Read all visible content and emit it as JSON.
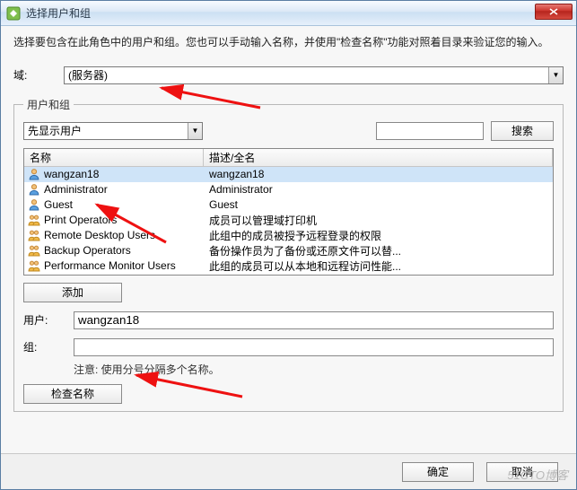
{
  "window": {
    "title": "选择用户和组"
  },
  "instruction": "选择要包含在此角色中的用户和组。您也可以手动输入名称，并使用\"检查名称\"功能对照着目录来验证您的输入。",
  "domain": {
    "label": "域:",
    "value": "(服务器)"
  },
  "group": {
    "legend": "用户和组",
    "filterValue": "先显示用户",
    "searchText": "",
    "searchButton": "搜索",
    "columns": {
      "name": "名称",
      "desc": "描述/全名"
    },
    "rows": [
      {
        "type": "user",
        "name": "wangzan18",
        "desc": "wangzan18",
        "selected": true
      },
      {
        "type": "user",
        "name": "Administrator",
        "desc": "Administrator",
        "selected": false
      },
      {
        "type": "user",
        "name": "Guest",
        "desc": "Guest",
        "selected": false
      },
      {
        "type": "group",
        "name": "Print Operators",
        "desc": "成员可以管理域打印机",
        "selected": false
      },
      {
        "type": "group",
        "name": "Remote Desktop Users",
        "desc": "此组中的成员被授予远程登录的权限",
        "selected": false
      },
      {
        "type": "group",
        "name": "Backup Operators",
        "desc": "备份操作员为了备份或还原文件可以替...",
        "selected": false
      },
      {
        "type": "group",
        "name": "Performance Monitor Users",
        "desc": "此组的成员可以从本地和远程访问性能...",
        "selected": false
      }
    ],
    "addButton": "添加"
  },
  "selected": {
    "usersLabel": "用户:",
    "usersValue": "wangzan18",
    "groupsLabel": "组:",
    "groupsValue": "",
    "note": "注意: 使用分号分隔多个名称。",
    "checkButton": "检查名称"
  },
  "footer": {
    "ok": "确定",
    "cancel": "取消"
  },
  "watermark": "51CTO博客"
}
